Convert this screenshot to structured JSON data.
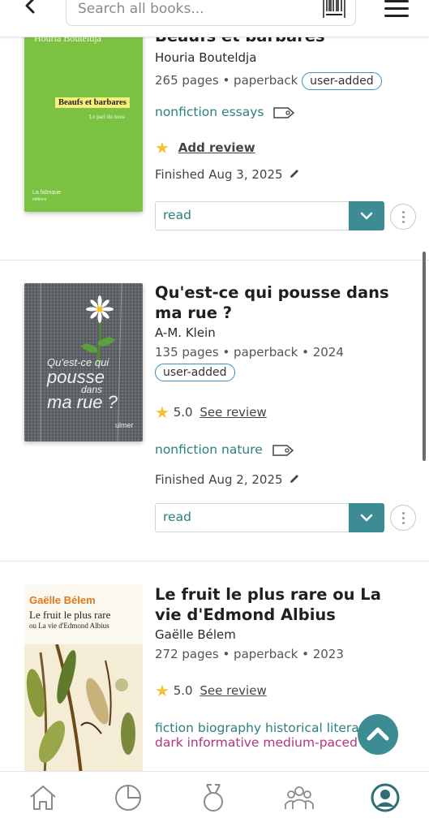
{
  "header": {
    "search_placeholder": "Search all books..."
  },
  "books": [
    {
      "cover": {
        "author": "Houria Bouteldja",
        "title": "Beaufs et barbares",
        "subtitle": "Le pari du nous",
        "publisher": "La fabrique",
        "publisher_sub": "éditions",
        "bg": "#7cc242"
      },
      "title": "Beaufs et barbares",
      "author": "Houria Bouteldja",
      "meta": "265 pages • paperback",
      "badge": "user-added",
      "tags": "nonfiction essays",
      "review_action": "Add review",
      "finished": "Finished Aug 3, 2025",
      "status": "read"
    },
    {
      "cover": {
        "title_line1": "Qu'est-ce qui",
        "title_line2": "pousse",
        "title_line3": "dans",
        "title_line4": "ma rue ?",
        "publisher": "ulmer"
      },
      "title": "Qu'est-ce qui pousse dans ma rue ?",
      "author": "A-M. Klein",
      "meta": "135 pages • paperback • 2024",
      "badge": "user-added",
      "rating": "5.0",
      "review_link": "See review",
      "tags": "nonfiction nature",
      "finished": "Finished Aug 2, 2025",
      "status": "read"
    },
    {
      "cover": {
        "author": "Gaëlle Bélem",
        "title": "Le fruit le plus rare",
        "subtitle": "ou La vie d'Edmond Albius"
      },
      "title": "Le fruit le plus rare ou La vie d'Edmond Albius",
      "author": "Gaëlle Bélem",
      "meta": "272 pages • paperback • 2023",
      "rating": "5.0",
      "review_link": "See review",
      "tags": "fiction biography historical literary",
      "moods": "dark informative medium-paced"
    }
  ],
  "colors": {
    "accent": "#3d8c94",
    "tag_green": "#2c7f7f",
    "mood_pink": "#b2357c",
    "pill_border": "#3a8fc4",
    "star": "#f2c230"
  },
  "nav": {
    "items": [
      "home-icon",
      "stats-icon",
      "challenges-icon",
      "community-icon",
      "profile-icon"
    ],
    "active": "profile-icon"
  }
}
